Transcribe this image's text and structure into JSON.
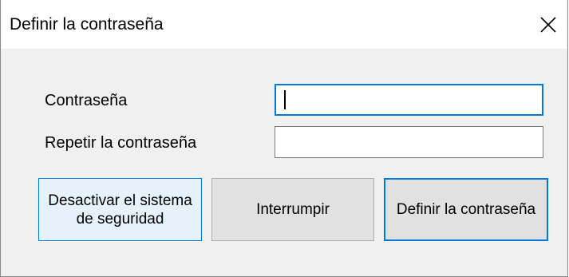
{
  "window": {
    "title": "Definir la contraseña",
    "close_icon": "close-icon"
  },
  "form": {
    "password_label": "Contraseña",
    "password_value": "",
    "repeat_label": "Repetir la contraseña",
    "repeat_value": ""
  },
  "buttons": {
    "deactivate_label": "Desactivar el sistema de seguridad",
    "abort_label": "Interrumpir",
    "define_label": "Definir la contraseña"
  },
  "colors": {
    "accent": "#0078d7",
    "body_background": "#f0f0f0",
    "button_background": "#e1e1e1",
    "hover_button_background": "#e5f1fb"
  }
}
